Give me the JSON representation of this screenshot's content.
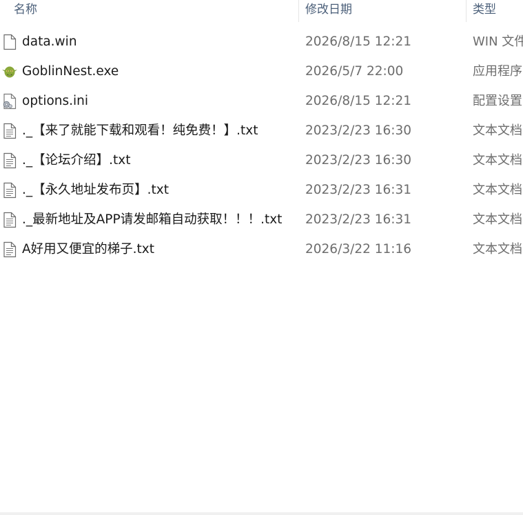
{
  "columns": {
    "name": "名称",
    "date": "修改日期",
    "type": "类型"
  },
  "files": [
    {
      "name": "data.win",
      "date": "2026/8/15 12:21",
      "type": "WIN 文件",
      "icon": "blank-file-icon"
    },
    {
      "name": "GoblinNest.exe",
      "date": "2026/5/7 22:00",
      "type": "应用程序",
      "icon": "goblin-app-icon"
    },
    {
      "name": "options.ini",
      "date": "2026/8/15 12:21",
      "type": "配置设置",
      "icon": "config-file-icon"
    },
    {
      "name": "._【来了就能下载和观看！纯免费！】.txt",
      "date": "2023/2/23 16:30",
      "type": "文本文档",
      "icon": "text-file-icon"
    },
    {
      "name": "._【论坛介绍】.txt",
      "date": "2023/2/23 16:30",
      "type": "文本文档",
      "icon": "text-file-icon"
    },
    {
      "name": "._【永久地址发布页】.txt",
      "date": "2023/2/23 16:31",
      "type": "文本文档",
      "icon": "text-file-icon"
    },
    {
      "name": "._最新地址及APP请发邮箱自动获取！！！.txt",
      "date": "2023/2/23 16:31",
      "type": "文本文档",
      "icon": "text-file-icon"
    },
    {
      "name": "A好用又便宜的梯子.txt",
      "date": "2026/3/22 11:16",
      "type": "文本文档",
      "icon": "text-file-icon"
    }
  ]
}
